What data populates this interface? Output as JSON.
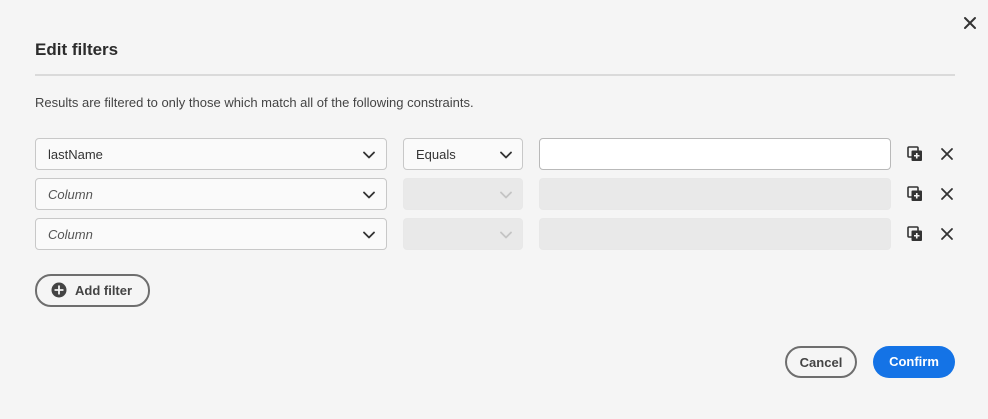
{
  "dialog": {
    "title": "Edit filters",
    "description": "Results are filtered to only those which match all of the following constraints.",
    "close_icon": "close-icon"
  },
  "filters": [
    {
      "column": "lastName",
      "column_placeholder": false,
      "operator": "Equals",
      "value": "",
      "enabled": true
    },
    {
      "column": "Column",
      "column_placeholder": true,
      "operator": "",
      "value": "",
      "enabled": false
    },
    {
      "column": "Column",
      "column_placeholder": true,
      "operator": "",
      "value": "",
      "enabled": false
    }
  ],
  "row_actions": {
    "duplicate_icon": "duplicate-icon",
    "remove_icon": "close-icon"
  },
  "add_filter": {
    "label": "Add filter",
    "icon": "add-circle-icon"
  },
  "footer": {
    "cancel_label": "Cancel",
    "confirm_label": "Confirm"
  },
  "colors": {
    "accent": "#1473e6",
    "background": "#f5f5f5",
    "disabled_field": "#e9e9e9",
    "border": "#c8c8c8"
  }
}
